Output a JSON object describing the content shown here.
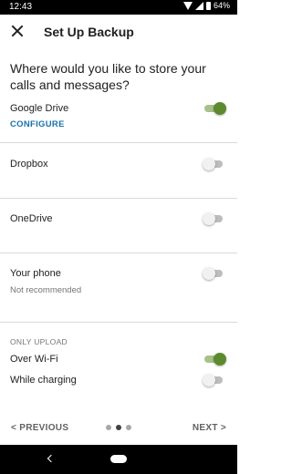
{
  "status_bar": {
    "time": "12:43",
    "battery": "64%"
  },
  "app_bar": {
    "title": "Set Up Backup",
    "close_icon": "close-icon"
  },
  "question": "Where would you like to store your calls and messages?",
  "options": [
    {
      "label": "Google Drive",
      "link": "CONFIGURE",
      "enabled": true
    },
    {
      "label": "Dropbox",
      "enabled": false
    },
    {
      "label": "OneDrive",
      "enabled": false
    },
    {
      "label": "Your phone",
      "subtitle": "Not recommended",
      "enabled": false
    }
  ],
  "upload": {
    "header": "ONLY UPLOAD",
    "items": [
      {
        "label": "Over Wi-Fi",
        "enabled": true
      },
      {
        "label": "While charging",
        "enabled": false
      }
    ]
  },
  "nav": {
    "previous": "< PREVIOUS",
    "next": "NEXT >",
    "page_count": 3,
    "current_page": 2
  },
  "colors": {
    "accent": "#5c8a2e",
    "link": "#1a73a8",
    "status_bar": "#000000"
  }
}
